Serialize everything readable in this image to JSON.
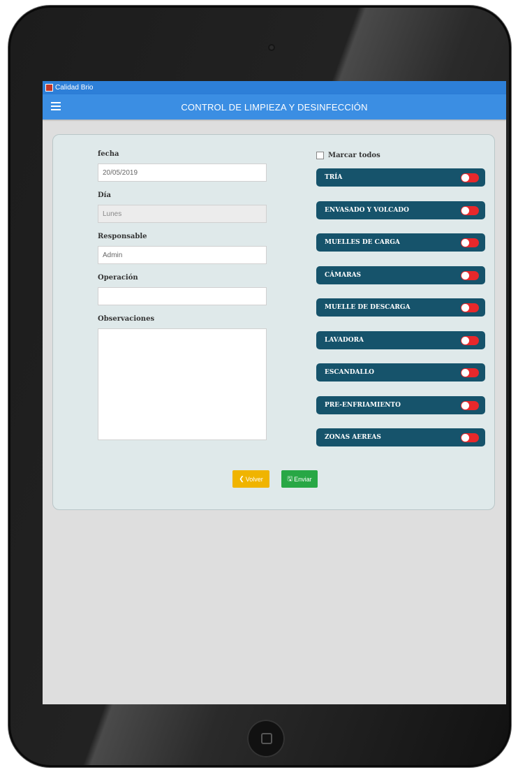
{
  "app": {
    "window_title": "Calidad Brio",
    "header_title": "CONTROL DE LIMPIEZA Y DESINFECCIÓN"
  },
  "form": {
    "fecha": {
      "label": "fecha",
      "value": "20/05/2019"
    },
    "dia": {
      "label": "Día",
      "value": "Lunes"
    },
    "responsable": {
      "label": "Responsable",
      "value": "Admin"
    },
    "operacion": {
      "label": "Operación",
      "value": ""
    },
    "observaciones": {
      "label": "Observaciones",
      "value": ""
    }
  },
  "zones": {
    "mark_all_label": "Marcar todos",
    "items": [
      {
        "label": "TRÍA",
        "state": "off"
      },
      {
        "label": "ENVASADO Y VOLCADO",
        "state": "off"
      },
      {
        "label": "MUELLES DE CARGA",
        "state": "off"
      },
      {
        "label": "CÁMARAS",
        "state": "off"
      },
      {
        "label": "MUELLE DE DESCARGA",
        "state": "off"
      },
      {
        "label": "LAVADORA",
        "state": "off"
      },
      {
        "label": "ESCANDALLO",
        "state": "off"
      },
      {
        "label": "PRE-ENFRIAMIENTO",
        "state": "off"
      },
      {
        "label": "ZONAS AEREAS",
        "state": "off"
      }
    ]
  },
  "actions": {
    "back_label": "Volver",
    "back_icon": "chevron-left-icon",
    "send_label": "Enviar",
    "send_icon": "save-icon"
  },
  "colors": {
    "header_blue": "#3b8ee3",
    "toggle_bar": "#16536b",
    "switch_off": "#e8282b",
    "back_button": "#f0b400",
    "send_button": "#28a745"
  }
}
